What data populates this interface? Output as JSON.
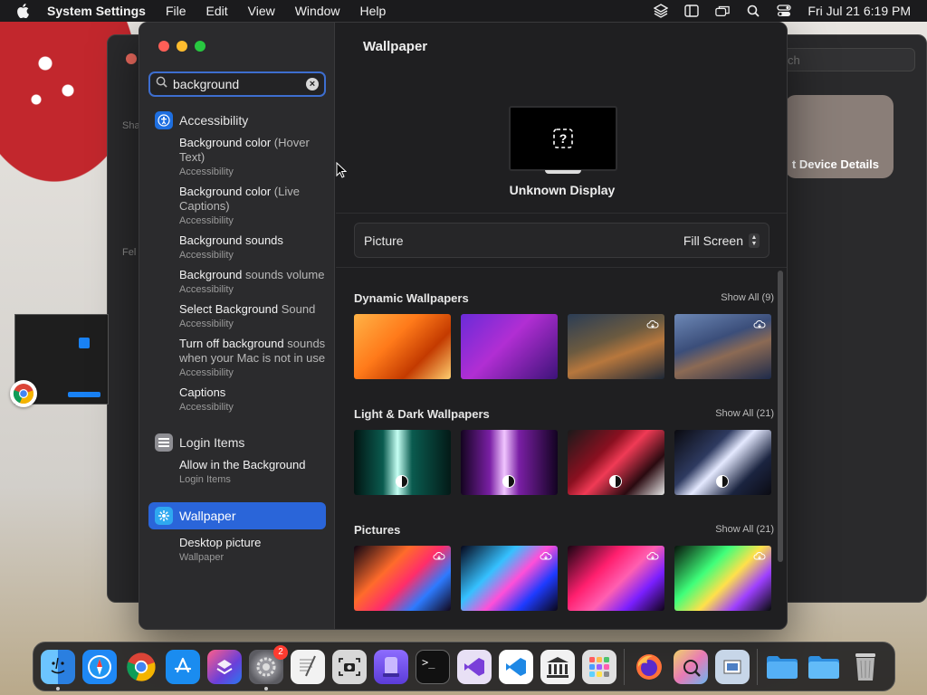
{
  "menubar": {
    "app_name": "System Settings",
    "items": [
      "File",
      "Edit",
      "View",
      "Window",
      "Help"
    ],
    "clock": "Fri Jul 21  6:19 PM"
  },
  "background_window": {
    "search_placeholder": "ch",
    "device_card_label": "t Device Details",
    "sidebar_labels": [
      "Sha",
      "Fel"
    ]
  },
  "sidebar": {
    "search": {
      "value": "background",
      "placeholder": "Search"
    },
    "groups": [
      {
        "category": "Accessibility",
        "icon": "accessibility-icon",
        "color": "#1e6fe0",
        "results": [
          {
            "title_bold": "Background color",
            "title_rest": " (Hover Text)",
            "subtitle": "Accessibility"
          },
          {
            "title_bold": "Background color",
            "title_rest": " (Live Captions)",
            "subtitle": "Accessibility"
          },
          {
            "title_bold": "Background sounds",
            "title_rest": "",
            "subtitle": "Accessibility"
          },
          {
            "title_bold": "Background",
            "title_rest": " sounds volume",
            "subtitle": "Accessibility"
          },
          {
            "title_bold": "Select Background",
            "title_rest": " Sound",
            "subtitle": "Accessibility"
          },
          {
            "title_bold": "Turn off background",
            "title_rest": " sounds when your Mac is not in use",
            "subtitle": "Accessibility"
          },
          {
            "title_bold": "Captions",
            "title_rest": "",
            "subtitle": "Accessibility"
          }
        ]
      },
      {
        "category": "Login Items",
        "icon": "login-items-icon",
        "color": "#8e8e93",
        "results": [
          {
            "title_bold": "Allow in the Background",
            "title_rest": "",
            "subtitle": "Login Items"
          }
        ]
      },
      {
        "category": "Wallpaper",
        "icon": "wallpaper-icon",
        "color": "#2fa8f0",
        "selected": true,
        "results": [
          {
            "title_bold": "Desktop picture",
            "title_rest": "",
            "subtitle": "Wallpaper"
          }
        ]
      }
    ]
  },
  "main": {
    "title": "Wallpaper",
    "display_name": "Unknown Display",
    "picture_label": "Picture",
    "picture_value": "Fill Screen",
    "sections": [
      {
        "name": "Dynamic Wallpapers",
        "show_all": "Show All (9)",
        "thumbs": [
          "w1",
          "w2",
          "w3",
          "w4"
        ],
        "cloud": [
          false,
          false,
          true,
          true
        ],
        "mode": [
          false,
          false,
          false,
          false
        ]
      },
      {
        "name": "Light & Dark Wallpapers",
        "show_all": "Show All (21)",
        "thumbs": [
          "w5",
          "w6",
          "w7",
          "w8"
        ],
        "cloud": [
          false,
          false,
          false,
          false
        ],
        "mode": [
          true,
          true,
          true,
          true
        ]
      },
      {
        "name": "Pictures",
        "show_all": "Show All (21)",
        "thumbs": [
          "w9",
          "w10",
          "w11",
          "w12"
        ],
        "cloud": [
          true,
          true,
          true,
          true
        ],
        "mode": [
          false,
          false,
          false,
          false
        ]
      }
    ]
  },
  "dock": {
    "apps": [
      {
        "name": "finder",
        "bg": "#3aa0f0"
      },
      {
        "name": "safari",
        "bg": "#1e88f5"
      },
      {
        "name": "chrome",
        "bg": "#ffffff"
      },
      {
        "name": "app-store",
        "bg": "#1a8cf0"
      },
      {
        "name": "shortcuts",
        "bg": "#6a3fd9"
      },
      {
        "name": "system-settings",
        "bg": "#8e8e93",
        "badge": "2",
        "running": true
      },
      {
        "name": "textedit",
        "bg": "#f2f2f2"
      },
      {
        "name": "screenshot",
        "bg": "#d8d8d8"
      },
      {
        "name": "simulator",
        "bg": "#6b4fd8"
      },
      {
        "name": "terminal",
        "bg": "#111111"
      },
      {
        "name": "visual-studio",
        "bg": "#e8e0f5"
      },
      {
        "name": "vscode",
        "bg": "#ffffff"
      },
      {
        "name": "library",
        "bg": "#f2f2f2"
      },
      {
        "name": "launchpad",
        "bg": "#e0e0e0"
      },
      {
        "name": "firefox",
        "bg": "#2b2b2b"
      },
      {
        "name": "grapher",
        "bg": "#e9d37a"
      },
      {
        "name": "preview",
        "bg": "#c7d6e8"
      },
      {
        "name": "folder-1",
        "bg": "#2f8fe0"
      },
      {
        "name": "folder-2",
        "bg": "#35a3f0"
      },
      {
        "name": "trash",
        "bg": "#8a8a8a"
      }
    ]
  }
}
